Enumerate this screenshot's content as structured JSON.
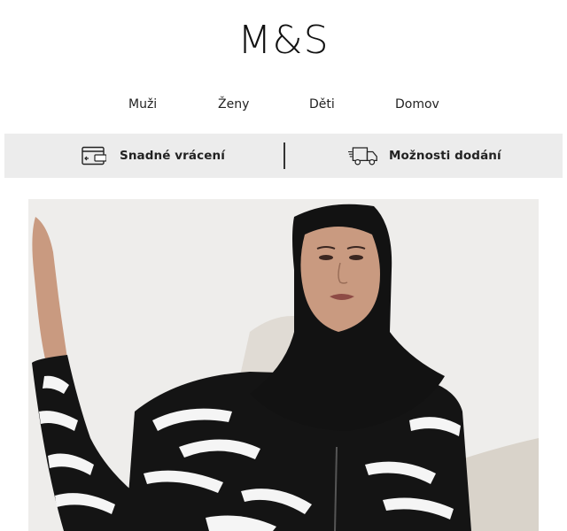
{
  "header": {
    "logo_text": "M&S"
  },
  "nav": {
    "items": [
      {
        "label": "Muži"
      },
      {
        "label": "Ženy"
      },
      {
        "label": "Děti"
      },
      {
        "label": "Domov"
      }
    ]
  },
  "usp_bar": {
    "returns": {
      "label": "Snadné vrácení",
      "icon": "return-card-icon"
    },
    "delivery": {
      "label": "Možnosti dodání",
      "icon": "delivery-truck-icon"
    },
    "background_color": "#ececec"
  },
  "hero": {
    "image": "model-in-black-white-zebra-print-burkini",
    "colors": {
      "background": "#eeedeb",
      "garment_black": "#141414",
      "garment_white": "#f5f5f5",
      "skin": "#c99a80"
    }
  }
}
